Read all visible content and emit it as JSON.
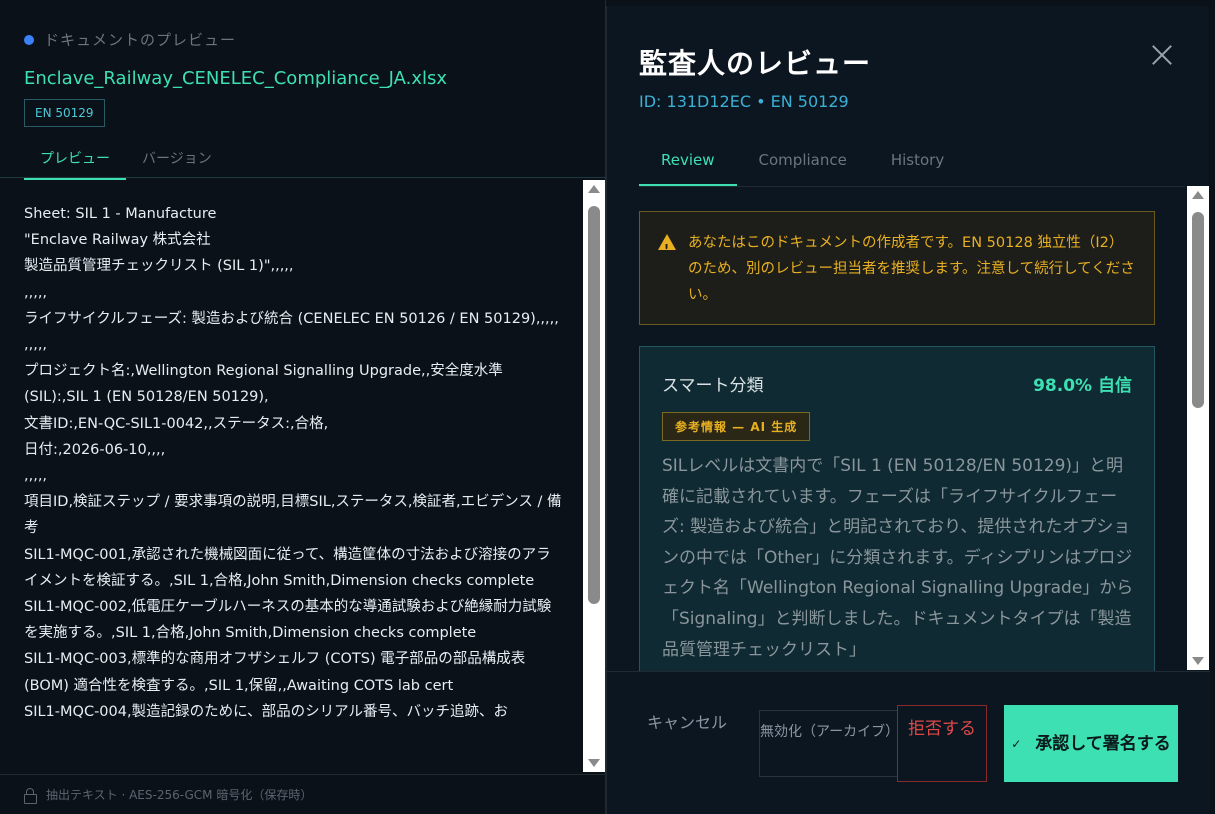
{
  "left": {
    "header": "ドキュメントのプレビュー",
    "filename": "Enclave_Railway_CENELEC_Compliance_JA.xlsx",
    "tag": "EN 50129",
    "tabs": [
      "プレビュー",
      "バージョン"
    ],
    "lines": [
      "Sheet: SIL 1 - Manufacture",
      "\"Enclave Railway 株式会社",
      "製造品質管理チェックリスト (SIL 1)\",,,,,",
      ",,,,,",
      "ライフサイクルフェーズ: 製造および統合 (CENELEC EN 50126 / EN 50129),,,,,",
      ",,,,,",
      "プロジェクト名:,Wellington Regional Signalling Upgrade,,安全度水準 (SIL):,SIL 1 (EN 50128/EN 50129),",
      "文書ID:,EN-QC-SIL1-0042,,ステータス:,合格,",
      "日付:,2026-06-10,,,,",
      ",,,,,",
      "項目ID,検証ステップ / 要求事項の説明,目標SIL,ステータス,検証者,エビデンス / 備考",
      "SIL1-MQC-001,承認された機械図面に従って、構造筐体の寸法および溶接のアライメントを検証する。,SIL 1,合格,John Smith,Dimension checks complete",
      "SIL1-MQC-002,低電圧ケーブルハーネスの基本的な導通試験および絶縁耐力試験を実施する。,SIL 1,合格,John Smith,Dimension checks complete",
      "SIL1-MQC-003,標準的な商用オフザシェルフ (COTS) 電子部品の部品構成表 (BOM) 適合性を検査する。,SIL 1,保留,,Awaiting COTS lab cert",
      "SIL1-MQC-004,製造記録のために、部品のシリアル番号、バッチ追跡、お"
    ],
    "footer": "抽出テキスト · AES-256-GCM 暗号化（保存時）"
  },
  "right": {
    "title": "監査人のレビュー",
    "subtitle": "ID: 131D12EC • EN 50129",
    "tabs": [
      "Review",
      "Compliance",
      "History"
    ],
    "warning": "あなたはこのドキュメントの作成者です。EN 50128 独立性（I2）のため、別のレビュー担当者を推奨します。注意して続行してください。",
    "smart": {
      "title": "スマート分類",
      "confidence": "98.0% 自信",
      "badge": "参考情報 — AI 生成",
      "body": "SILレベルは文書内で「SIL 1 (EN 50128/EN 50129)」と明確に記載されています。フェーズは「ライフサイクルフェーズ: 製造および統合」と明記されており、提供されたオプションの中では「Other」に分類されます。ディシプリンはプロジェクト名「Wellington Regional Signalling Upgrade」から「Signaling」と判断しました。ドキュメントタイプは「製造品質管理チェックリスト」"
    },
    "buttons": {
      "cancel": "キャンセル",
      "archive": "無効化（アーカイブ）",
      "reject": "拒否する",
      "approve": "承認して署名する"
    }
  }
}
